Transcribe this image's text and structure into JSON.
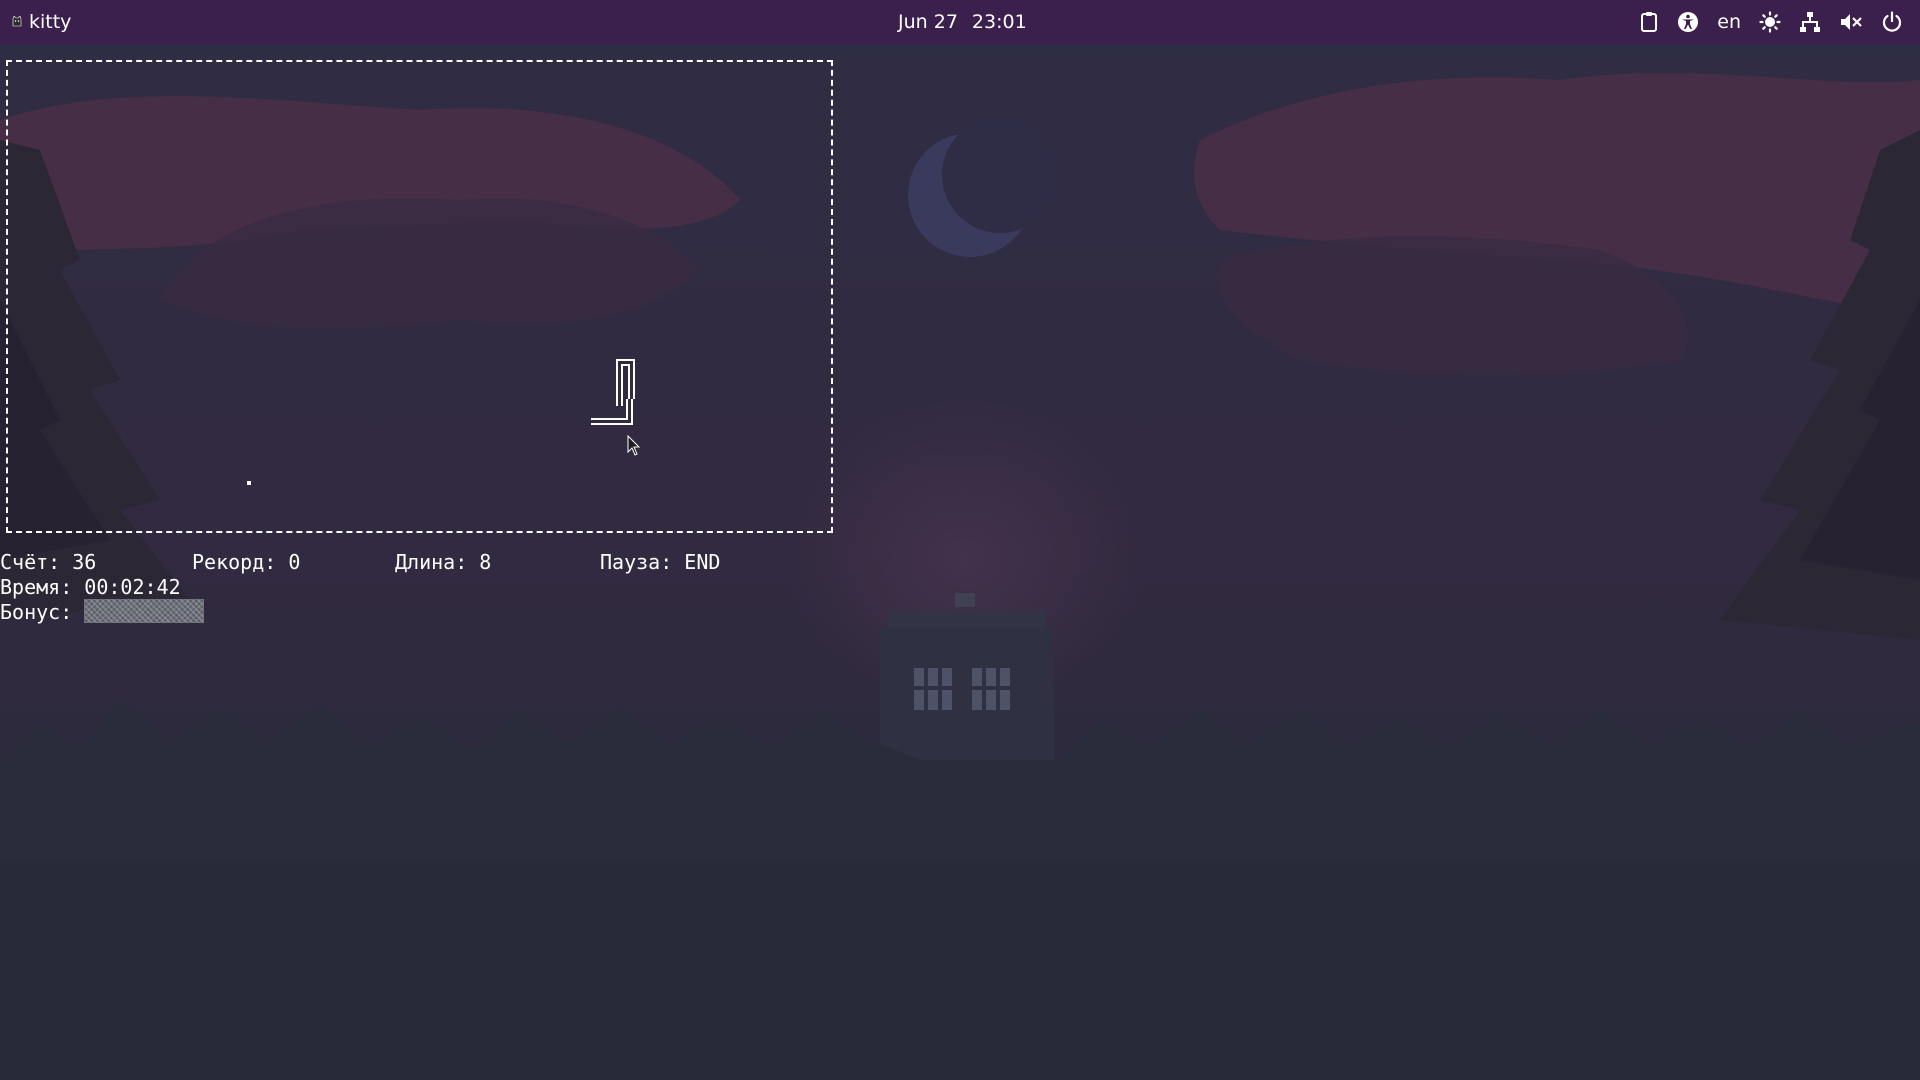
{
  "topbar": {
    "app_name": "kitty",
    "date": "Jun 27",
    "time": "23:01",
    "tray": {
      "clipboard_icon": "clipboard-icon",
      "accessibility_icon": "accessibility-icon",
      "language": "en",
      "brightness_icon": "sun-icon",
      "network_icon": "network-wired-icon",
      "volume_icon": "volume-muted-icon",
      "power_icon": "power-icon"
    }
  },
  "game": {
    "score_label": "Счёт:",
    "score": "36",
    "record_label": "Рекорд:",
    "record": "0",
    "length_label": "Длина:",
    "length": "8",
    "pause_label": "Пауза:",
    "pause_key": "END",
    "time_label": "Время:",
    "time": "00:02:42",
    "bonus_label": "Бонус:",
    "bonus_level": 1.0
  },
  "colors": {
    "topbar_bg": "#3b1f4d",
    "text": "#ffffff",
    "desktop_bg": "#282a3a"
  }
}
